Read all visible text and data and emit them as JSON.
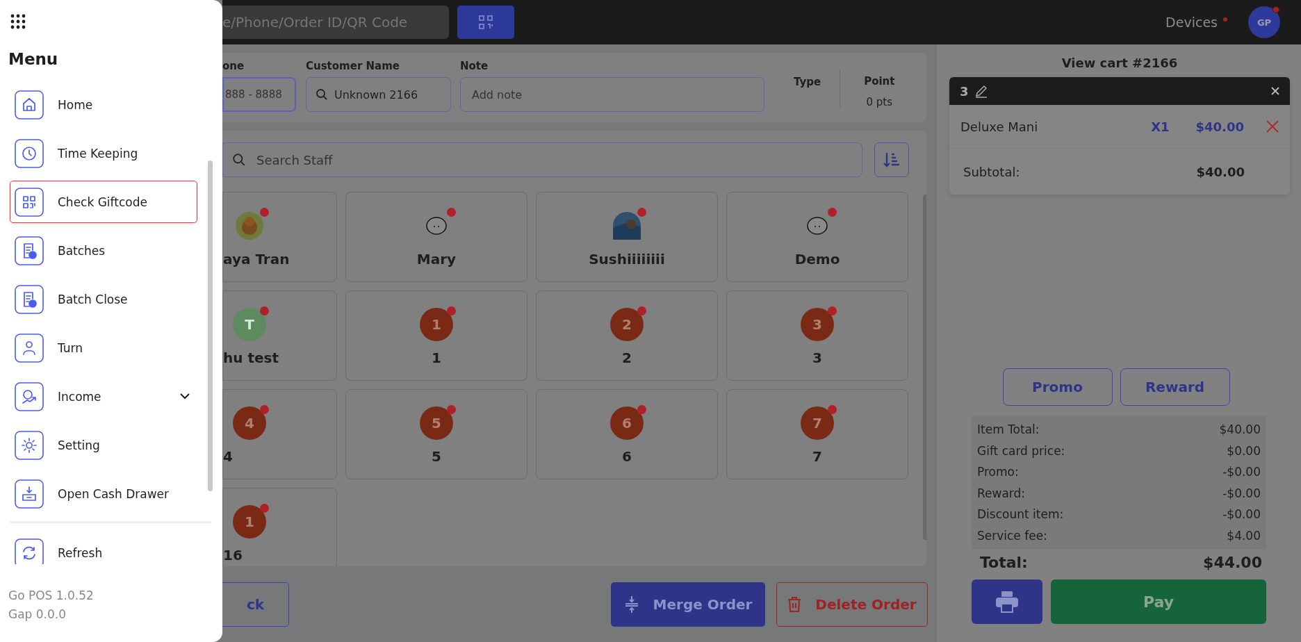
{
  "top_bar": {
    "search": {
      "placeholder": "e/Phone/Order ID/QR Code"
    },
    "devices": {
      "label": "Devices",
      "alert": true
    },
    "avatar": {
      "initials": "GP",
      "alert": true
    }
  },
  "drawer": {
    "title": "Menu",
    "items": [
      {
        "label": "Home",
        "selected": false,
        "expandable": false
      },
      {
        "label": "Time Keeping",
        "selected": false,
        "expandable": false
      },
      {
        "label": "Check Giftcode",
        "selected": true,
        "expandable": false
      },
      {
        "label": "Batches",
        "selected": false,
        "expandable": false
      },
      {
        "label": "Batch Close",
        "selected": false,
        "expandable": false
      },
      {
        "label": "Turn",
        "selected": false,
        "expandable": false
      },
      {
        "label": "Income",
        "selected": false,
        "expandable": true
      },
      {
        "label": "Setting",
        "selected": false,
        "expandable": false
      },
      {
        "label": "Open Cash Drawer",
        "selected": false,
        "expandable": false
      },
      {
        "label": "Refresh",
        "selected": false,
        "expandable": false
      }
    ],
    "versions": [
      "Go POS 1.0.52",
      "Gap 0.0.0"
    ]
  },
  "customer": {
    "phone": {
      "label": "one",
      "placeholder": "888 - 8888"
    },
    "name": {
      "label": "Customer Name",
      "value": "Unknown 2166"
    },
    "note": {
      "label": "Note",
      "placeholder": "Add note"
    },
    "type": {
      "label": "Type"
    },
    "point": {
      "label": "Point",
      "value": "0 pts"
    }
  },
  "staff": {
    "search": {
      "placeholder": "Search Staff"
    },
    "tiles": [
      {
        "name": "aya Tran",
        "alert": true
      },
      {
        "name": "Mary",
        "alert": true
      },
      {
        "name": "Sushiiiiiiii",
        "alert": true
      },
      {
        "name": "Demo",
        "alert": true
      },
      {
        "name": "hu test",
        "avatar": {
          "kind": "initial",
          "text": "T"
        },
        "alert": true
      },
      {
        "name": "1",
        "avatar": {
          "kind": "number",
          "text": "1"
        },
        "alert": true
      },
      {
        "name": "2",
        "avatar": {
          "kind": "number",
          "text": "2"
        },
        "alert": true
      },
      {
        "name": "3",
        "avatar": {
          "kind": "number",
          "text": "3"
        },
        "alert": true
      },
      {
        "name": "4",
        "avatar": {
          "kind": "number",
          "text": "4"
        },
        "alert": true
      },
      {
        "name": "5",
        "avatar": {
          "kind": "number",
          "text": "5"
        },
        "alert": true
      },
      {
        "name": "6",
        "avatar": {
          "kind": "number",
          "text": "6"
        },
        "alert": true
      },
      {
        "name": "7",
        "avatar": {
          "kind": "number",
          "text": "7"
        },
        "alert": true
      },
      {
        "name": "16",
        "avatar": {
          "kind": "number",
          "text": "1"
        },
        "alert": true
      }
    ]
  },
  "actions": [
    {
      "label": "ck",
      "kind": "outline"
    },
    {
      "label": "Merge Order",
      "kind": "merge"
    },
    {
      "label": "Delete Order",
      "kind": "delete"
    }
  ],
  "cart": {
    "title": "View cart #2166",
    "ticket": "3",
    "items": [
      {
        "name": "Deluxe Mani",
        "qty": "X1",
        "price": "$40.00"
      }
    ],
    "subtotal": {
      "label": "Subtotal:",
      "value": "$40.00"
    },
    "buttons": [
      "Promo",
      "Reward"
    ],
    "summary": [
      {
        "label": "Item Total:",
        "value": "$40.00"
      },
      {
        "label": "Gift card price:",
        "value": "$0.00"
      },
      {
        "label": "Promo:",
        "value": "-$0.00"
      },
      {
        "label": "Reward:",
        "value": "-$0.00"
      },
      {
        "label": "Discount item:",
        "value": "-$0.00"
      },
      {
        "label": "Service fee:",
        "value": "$4.00"
      }
    ],
    "total": {
      "label": "Total:",
      "value": "$44.00"
    },
    "pay": "Pay"
  }
}
